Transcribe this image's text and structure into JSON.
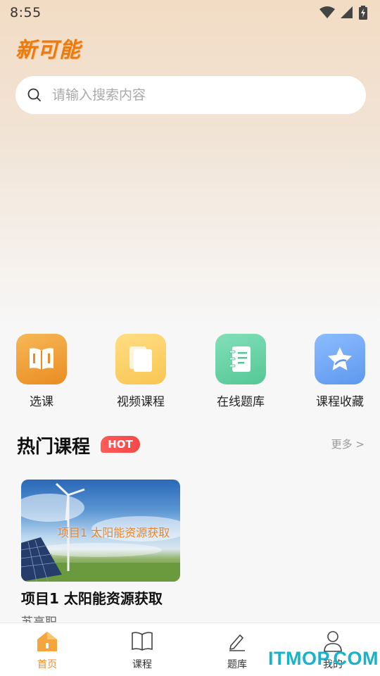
{
  "status_bar": {
    "time": "8:55",
    "icons": [
      "wifi-icon",
      "cell-signal-icon",
      "battery-charging-icon"
    ]
  },
  "app": {
    "logo_text": "新可能"
  },
  "search": {
    "placeholder": "请输入搜索内容",
    "value": "",
    "icon": "search-icon"
  },
  "quick_actions": [
    {
      "label": "选课",
      "icon": "open-book-icon",
      "color": "#f0a340"
    },
    {
      "label": "视频课程",
      "icon": "documents-icon",
      "color": "#fcd06a"
    },
    {
      "label": "在线题库",
      "icon": "notebook-icon",
      "color": "#6fd3a9"
    },
    {
      "label": "课程收藏",
      "icon": "star-icon",
      "color": "#76adf6"
    }
  ],
  "hot_courses": {
    "title": "热门课程",
    "badge": "HOT",
    "more_label": "更多 >",
    "items": [
      {
        "thumbnail_text": "项目1 太阳能资源获取",
        "title": "项目1 太阳能资源获取",
        "school": "苏高职"
      }
    ]
  },
  "tab_bar": {
    "active_color": "#ef8d2a",
    "items": [
      {
        "label": "首页",
        "icon": "home-icon",
        "active": true
      },
      {
        "label": "课程",
        "icon": "book-icon",
        "active": false
      },
      {
        "label": "题库",
        "icon": "pencil-icon",
        "active": false
      },
      {
        "label": "我的",
        "icon": "user-icon",
        "active": false
      }
    ]
  },
  "watermark": {
    "text": "ITMOP.COM"
  }
}
